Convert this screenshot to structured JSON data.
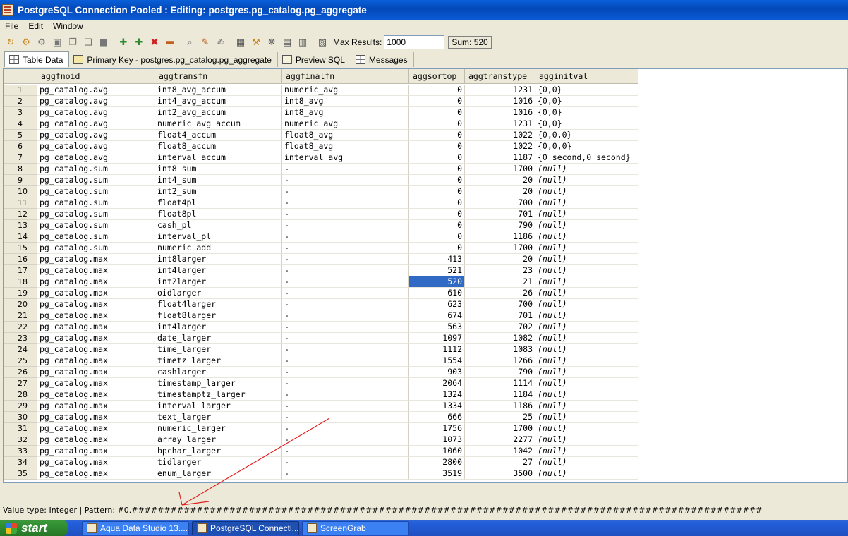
{
  "window": {
    "title": "PostgreSQL Connection Pooled : Editing: postgres.pg_catalog.pg_aggregate"
  },
  "menu": [
    "File",
    "Edit",
    "Window"
  ],
  "toolbar": {
    "max_results_label": "Max Results:",
    "max_results_value": "1000",
    "sum_text": "Sum: 520"
  },
  "tabs": [
    {
      "label": "Table Data"
    },
    {
      "label": "Primary Key - postgres.pg_catalog.pg_aggregate"
    },
    {
      "label": "Preview SQL"
    },
    {
      "label": "Messages"
    }
  ],
  "grid": {
    "columns": [
      "",
      "aggfnoid",
      "aggtransfn",
      "aggfinalfn",
      "aggsortop",
      "aggtranstype",
      "agginitval"
    ],
    "selected": {
      "row": 18,
      "column": "aggsortop"
    },
    "rows": [
      [
        "1",
        "pg_catalog.avg",
        "int8_avg_accum",
        "numeric_avg",
        "0",
        "1231",
        "{0,0}"
      ],
      [
        "2",
        "pg_catalog.avg",
        "int4_avg_accum",
        "int8_avg",
        "0",
        "1016",
        "{0,0}"
      ],
      [
        "3",
        "pg_catalog.avg",
        "int2_avg_accum",
        "int8_avg",
        "0",
        "1016",
        "{0,0}"
      ],
      [
        "4",
        "pg_catalog.avg",
        "numeric_avg_accum",
        "numeric_avg",
        "0",
        "1231",
        "{0,0}"
      ],
      [
        "5",
        "pg_catalog.avg",
        "float4_accum",
        "float8_avg",
        "0",
        "1022",
        "{0,0,0}"
      ],
      [
        "6",
        "pg_catalog.avg",
        "float8_accum",
        "float8_avg",
        "0",
        "1022",
        "{0,0,0}"
      ],
      [
        "7",
        "pg_catalog.avg",
        "interval_accum",
        "interval_avg",
        "0",
        "1187",
        "{0 second,0 second}"
      ],
      [
        "8",
        "pg_catalog.sum",
        "int8_sum",
        "-",
        "0",
        "1700",
        "(null)"
      ],
      [
        "9",
        "pg_catalog.sum",
        "int4_sum",
        "-",
        "0",
        "20",
        "(null)"
      ],
      [
        "10",
        "pg_catalog.sum",
        "int2_sum",
        "-",
        "0",
        "20",
        "(null)"
      ],
      [
        "11",
        "pg_catalog.sum",
        "float4pl",
        "-",
        "0",
        "700",
        "(null)"
      ],
      [
        "12",
        "pg_catalog.sum",
        "float8pl",
        "-",
        "0",
        "701",
        "(null)"
      ],
      [
        "13",
        "pg_catalog.sum",
        "cash_pl",
        "-",
        "0",
        "790",
        "(null)"
      ],
      [
        "14",
        "pg_catalog.sum",
        "interval_pl",
        "-",
        "0",
        "1186",
        "(null)"
      ],
      [
        "15",
        "pg_catalog.sum",
        "numeric_add",
        "-",
        "0",
        "1700",
        "(null)"
      ],
      [
        "16",
        "pg_catalog.max",
        "int8larger",
        "-",
        "413",
        "20",
        "(null)"
      ],
      [
        "17",
        "pg_catalog.max",
        "int4larger",
        "-",
        "521",
        "23",
        "(null)"
      ],
      [
        "18",
        "pg_catalog.max",
        "int2larger",
        "-",
        "520",
        "21",
        "(null)"
      ],
      [
        "19",
        "pg_catalog.max",
        "oidlarger",
        "-",
        "610",
        "26",
        "(null)"
      ],
      [
        "20",
        "pg_catalog.max",
        "float4larger",
        "-",
        "623",
        "700",
        "(null)"
      ],
      [
        "21",
        "pg_catalog.max",
        "float8larger",
        "-",
        "674",
        "701",
        "(null)"
      ],
      [
        "22",
        "pg_catalog.max",
        "int4larger",
        "-",
        "563",
        "702",
        "(null)"
      ],
      [
        "23",
        "pg_catalog.max",
        "date_larger",
        "-",
        "1097",
        "1082",
        "(null)"
      ],
      [
        "24",
        "pg_catalog.max",
        "time_larger",
        "-",
        "1112",
        "1083",
        "(null)"
      ],
      [
        "25",
        "pg_catalog.max",
        "timetz_larger",
        "-",
        "1554",
        "1266",
        "(null)"
      ],
      [
        "26",
        "pg_catalog.max",
        "cashlarger",
        "-",
        "903",
        "790",
        "(null)"
      ],
      [
        "27",
        "pg_catalog.max",
        "timestamp_larger",
        "-",
        "2064",
        "1114",
        "(null)"
      ],
      [
        "28",
        "pg_catalog.max",
        "timestamptz_larger",
        "-",
        "1324",
        "1184",
        "(null)"
      ],
      [
        "29",
        "pg_catalog.max",
        "interval_larger",
        "-",
        "1334",
        "1186",
        "(null)"
      ],
      [
        "30",
        "pg_catalog.max",
        "text_larger",
        "-",
        "666",
        "25",
        "(null)"
      ],
      [
        "31",
        "pg_catalog.max",
        "numeric_larger",
        "-",
        "1756",
        "1700",
        "(null)"
      ],
      [
        "32",
        "pg_catalog.max",
        "array_larger",
        "-",
        "1073",
        "2277",
        "(null)"
      ],
      [
        "33",
        "pg_catalog.max",
        "bpchar_larger",
        "-",
        "1060",
        "1042",
        "(null)"
      ],
      [
        "34",
        "pg_catalog.max",
        "tidlarger",
        "-",
        "2800",
        "27",
        "(null)"
      ],
      [
        "35",
        "pg_catalog.max",
        "enum_larger",
        "-",
        "3519",
        "3500",
        "(null)"
      ]
    ]
  },
  "status": {
    "text": "Value type: Integer | Pattern: #0.#################################################################################################"
  },
  "taskbar": {
    "start_label": "start",
    "tasks": [
      "Aqua Data Studio 13....",
      "PostgreSQL Connecti...",
      "ScreenGrab"
    ]
  },
  "colors": {
    "selection": "#316ac5",
    "titlebar": "#0349b8",
    "annotation_arrow": "#e02020"
  }
}
